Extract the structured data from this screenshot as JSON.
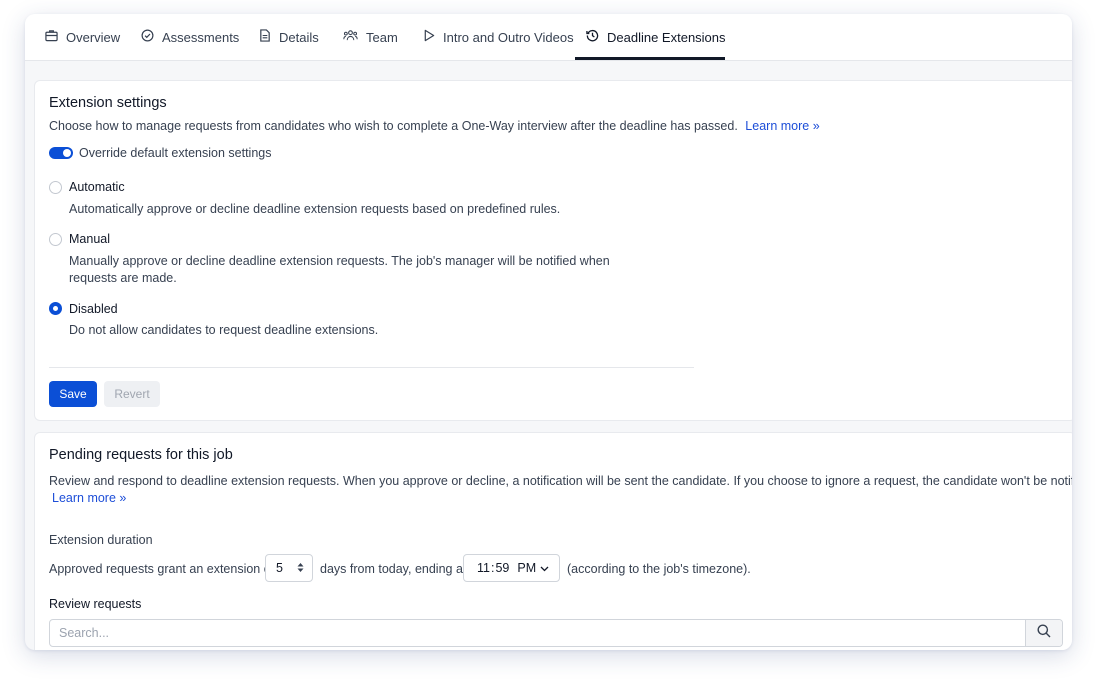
{
  "tabs": [
    {
      "label": "Overview",
      "icon": "briefcase-icon"
    },
    {
      "label": "Assessments",
      "icon": "check-circle-icon"
    },
    {
      "label": "Details",
      "icon": "document-icon"
    },
    {
      "label": "Team",
      "icon": "team-icon"
    },
    {
      "label": "Intro and Outro Videos",
      "icon": "play-icon"
    },
    {
      "label": "Deadline Extensions",
      "icon": "history-icon",
      "active": true
    }
  ],
  "extension_settings": {
    "title": "Extension settings",
    "description": "Choose how to manage requests from candidates who wish to complete a One-Way interview after the deadline has passed.",
    "learn_more": "Learn more »",
    "override_label": "Override default extension settings",
    "override_enabled": true,
    "options": [
      {
        "label": "Automatic",
        "description": "Automatically approve or decline deadline extension requests based on predefined rules.",
        "selected": false
      },
      {
        "label": "Manual",
        "description_line1": "Manually approve or decline deadline extension requests. The job's manager will be notified when",
        "description_line2": "requests are made.",
        "selected": false
      },
      {
        "label": "Disabled",
        "description": "Do not allow candidates to request deadline extensions.",
        "selected": true
      }
    ],
    "save_label": "Save",
    "revert_label": "Revert"
  },
  "pending": {
    "title": "Pending requests for this job",
    "description": "Review and respond to deadline extension requests. When you approve or decline, a notification will be sent the candidate. If you choose to ignore a request, the candidate won't be notified.",
    "learn_more": "Learn more »",
    "duration_label": "Extension duration",
    "approved_prefix": "Approved requests grant an extension of",
    "days_value": "5",
    "days_suffix": "days from today, ending at",
    "time_hour": "11",
    "time_minute": "59",
    "time_ampm": "PM",
    "timezone_note": "(according to the job's timezone).",
    "review_label": "Review requests",
    "search_placeholder": "Search..."
  },
  "colors": {
    "accent": "#0b4fd6",
    "text": "#374151",
    "link": "#1d4ed8"
  }
}
